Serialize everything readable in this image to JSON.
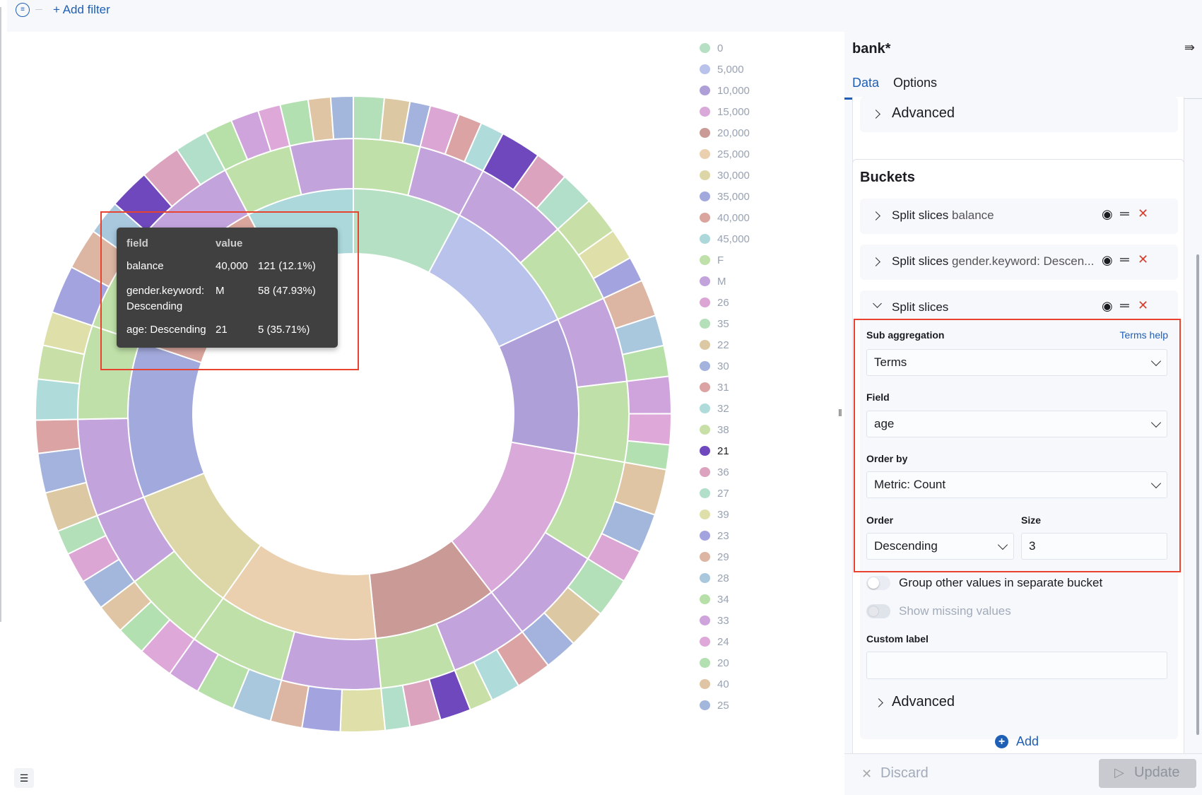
{
  "filterbar": {
    "add_filter": "+ Add filter",
    "icon": "filter-icon"
  },
  "tooltip": {
    "header": [
      "field",
      "value"
    ],
    "rows": [
      [
        "balance",
        "40,000",
        "121 (12.1%)"
      ],
      [
        "gender.keyword: Descending",
        "M",
        "58 (47.93%)"
      ],
      [
        "age: Descending",
        "21",
        "5 (35.71%)"
      ]
    ]
  },
  "panel": {
    "title": "bank*",
    "tabs": [
      {
        "label": "Data",
        "active": true
      },
      {
        "label": "Options",
        "active": false
      }
    ],
    "advanced_top": "Advanced",
    "buckets_title": "Buckets",
    "rows": [
      {
        "title": "Split slices",
        "detail": "balance",
        "expanded": false
      },
      {
        "title": "Split slices",
        "detail": "gender.keyword: Descen...",
        "expanded": false
      },
      {
        "title": "Split slices",
        "detail": "",
        "expanded": true
      }
    ],
    "sub_agg_label": "Sub aggregation",
    "terms_help": "Terms help",
    "sub_agg_value": "Terms",
    "field_label": "Field",
    "field_value": "age",
    "order_by_label": "Order by",
    "order_by_value": "Metric: Count",
    "order_label": "Order",
    "order_value": "Descending",
    "size_label": "Size",
    "size_value": "3",
    "group_other": "Group other values in separate bucket",
    "group_other_on": false,
    "show_missing": "Show missing values",
    "show_missing_on": false,
    "custom_label": "Custom label",
    "custom_label_value": "",
    "advanced_bottom": "Advanced",
    "add": "Add",
    "discard": "Discard",
    "update": "Update"
  },
  "colors": {
    "accent": "#1f5fb5",
    "highlight": "#e8432e",
    "delete": "#d6402e"
  },
  "chart_data": {
    "type": "pie",
    "donut": true,
    "levels": [
      "balance",
      "gender.keyword",
      "age"
    ],
    "legend": [
      {
        "label": "0",
        "color": "#b6e0c4"
      },
      {
        "label": "5,000",
        "color": "#b9c2ea"
      },
      {
        "label": "10,000",
        "color": "#ae9fd8"
      },
      {
        "label": "15,000",
        "color": "#d9a9d9"
      },
      {
        "label": "20,000",
        "color": "#c99a96"
      },
      {
        "label": "25,000",
        "color": "#ebd0b0"
      },
      {
        "label": "30,000",
        "color": "#ddd7a8"
      },
      {
        "label": "35,000",
        "color": "#a2a9dc"
      },
      {
        "label": "40,000",
        "color": "#d9a59d"
      },
      {
        "label": "45,000",
        "color": "#acd8dc"
      },
      {
        "label": "F",
        "color": "#bfe0a8"
      },
      {
        "label": "M",
        "color": "#c3a3dc"
      },
      {
        "label": "26",
        "color": "#dca6d4"
      },
      {
        "label": "35",
        "color": "#b3dfb9"
      },
      {
        "label": "22",
        "color": "#dcc9a3"
      },
      {
        "label": "30",
        "color": "#a3b3dd"
      },
      {
        "label": "31",
        "color": "#dba3a3"
      },
      {
        "label": "32",
        "color": "#afdcdb"
      },
      {
        "label": "38",
        "color": "#c8e0a8"
      },
      {
        "label": "21",
        "color": "#6f48bd",
        "highlighted": true
      },
      {
        "label": "36",
        "color": "#dba3bd"
      },
      {
        "label": "27",
        "color": "#b2dfc9"
      },
      {
        "label": "39",
        "color": "#dfdfaa"
      },
      {
        "label": "23",
        "color": "#a3a3df"
      },
      {
        "label": "29",
        "color": "#dcb5a3"
      },
      {
        "label": "28",
        "color": "#a9c8de"
      },
      {
        "label": "34",
        "color": "#b6e0a8"
      },
      {
        "label": "33",
        "color": "#cfa3dc"
      },
      {
        "label": "24",
        "color": "#dea8d9"
      },
      {
        "label": "20",
        "color": "#b3e0b0"
      },
      {
        "label": "40",
        "color": "#dfc5a3"
      },
      {
        "label": "25",
        "color": "#a3b6dc"
      }
    ],
    "buckets": [
      {
        "key": "0",
        "count": 78,
        "children": [
          {
            "key": "F",
            "count": 39,
            "children": [
              [
                "35",
                6
              ],
              [
                "22",
                5
              ],
              [
                "30",
                4
              ]
            ]
          },
          {
            "key": "M",
            "count": 39,
            "children": [
              [
                "26",
                5
              ],
              [
                "31",
                4
              ],
              [
                "32",
                4
              ]
            ]
          }
        ]
      },
      {
        "key": "5,000",
        "count": 103,
        "children": [
          {
            "key": "M",
            "count": 55,
            "children": [
              [
                "21",
                6
              ],
              [
                "36",
                5
              ],
              [
                "27",
                5
              ]
            ]
          },
          {
            "key": "F",
            "count": 48,
            "children": [
              [
                "38",
                6
              ],
              [
                "39",
                5
              ],
              [
                "23",
                4
              ]
            ]
          }
        ]
      },
      {
        "key": "10,000",
        "count": 97,
        "children": [
          {
            "key": "M",
            "count": 50,
            "children": [
              [
                "29",
                6
              ],
              [
                "28",
                5
              ],
              [
                "34",
                5
              ]
            ]
          },
          {
            "key": "F",
            "count": 47,
            "children": [
              [
                "33",
                6
              ],
              [
                "24",
                5
              ],
              [
                "20",
                4
              ]
            ]
          }
        ]
      },
      {
        "key": "15,000",
        "count": 117,
        "children": [
          {
            "key": "F",
            "count": 60,
            "children": [
              [
                "40",
                7
              ],
              [
                "25",
                6
              ],
              [
                "26",
                5
              ]
            ]
          },
          {
            "key": "M",
            "count": 57,
            "children": [
              [
                "35",
                6
              ],
              [
                "22",
                6
              ],
              [
                "30",
                5
              ]
            ]
          }
        ]
      },
      {
        "key": "20,000",
        "count": 89,
        "children": [
          {
            "key": "M",
            "count": 45,
            "children": [
              [
                "31",
                6
              ],
              [
                "32",
                5
              ],
              [
                "38",
                4
              ]
            ]
          },
          {
            "key": "F",
            "count": 44,
            "children": [
              [
                "21",
                5
              ],
              [
                "36",
                5
              ],
              [
                "27",
                4
              ]
            ]
          }
        ]
      },
      {
        "key": "25,000",
        "count": 114,
        "children": [
          {
            "key": "M",
            "count": 58,
            "children": [
              [
                "39",
                7
              ],
              [
                "23",
                6
              ],
              [
                "29",
                5
              ]
            ]
          },
          {
            "key": "F",
            "count": 56,
            "children": [
              [
                "28",
                6
              ],
              [
                "34",
                6
              ],
              [
                "33",
                5
              ]
            ]
          }
        ]
      },
      {
        "key": "30,000",
        "count": 92,
        "children": [
          {
            "key": "F",
            "count": 48,
            "children": [
              [
                "24",
                6
              ],
              [
                "20",
                5
              ],
              [
                "40",
                5
              ]
            ]
          },
          {
            "key": "M",
            "count": 44,
            "children": [
              [
                "25",
                5
              ],
              [
                "26",
                5
              ],
              [
                "35",
                4
              ]
            ]
          }
        ]
      },
      {
        "key": "35,000",
        "count": 112,
        "children": [
          {
            "key": "M",
            "count": 57,
            "children": [
              [
                "22",
                6
              ],
              [
                "30",
                6
              ],
              [
                "31",
                5
              ]
            ]
          },
          {
            "key": "F",
            "count": 55,
            "children": [
              [
                "32",
                6
              ],
              [
                "38",
                5
              ],
              [
                "39",
                5
              ]
            ]
          }
        ]
      },
      {
        "key": "40,000",
        "count": 121,
        "children": [
          {
            "key": "F",
            "count": 63,
            "children": [
              [
                "23",
                7
              ],
              [
                "29",
                6
              ],
              [
                "28",
                5
              ]
            ]
          },
          {
            "key": "M",
            "count": 58,
            "children": [
              [
                "21",
                5
              ],
              [
                "36",
                5
              ],
              [
                "27",
                4
              ]
            ]
          }
        ]
      },
      {
        "key": "45,000",
        "count": 77,
        "children": [
          {
            "key": "F",
            "count": 40,
            "children": [
              [
                "34",
                5
              ],
              [
                "33",
                5
              ],
              [
                "24",
                4
              ]
            ]
          },
          {
            "key": "M",
            "count": 37,
            "children": [
              [
                "20",
                5
              ],
              [
                "40",
                4
              ],
              [
                "25",
                4
              ]
            ]
          }
        ]
      }
    ]
  }
}
